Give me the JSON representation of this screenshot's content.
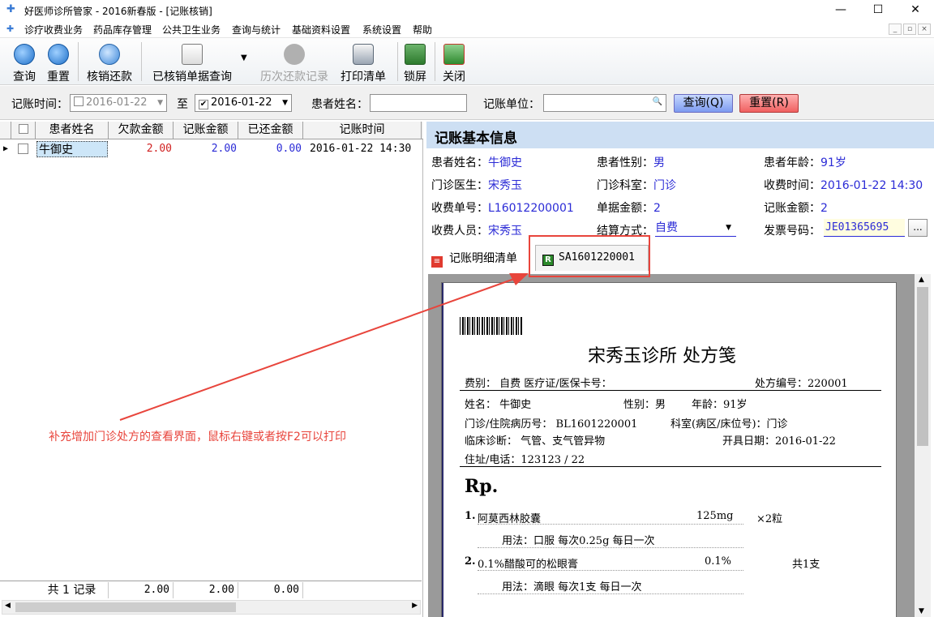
{
  "window": {
    "title": "好医师诊所管家 - 2016新春版 - [记账核销]",
    "minimize": "—",
    "maximize": "☐",
    "close": "✕"
  },
  "menu": [
    "诊疗收费业务",
    "药品库存管理",
    "公共卫生业务",
    "查询与统计",
    "基础资料设置",
    "系统设置",
    "帮助"
  ],
  "toolbar": {
    "query": "查询",
    "reset": "重置",
    "writeoff_repay": "核销还款",
    "writeoff_query": "已核销单据查询",
    "history": "历次还款记录",
    "print": "打印清单",
    "lock": "锁屏",
    "close": "关闭"
  },
  "filter": {
    "time_label": "记账时间：",
    "date_from": "2016-01-22",
    "to_label": "至",
    "date_to": "2016-01-22",
    "patient_label": "患者姓名：",
    "unit_label": "记账单位：",
    "query_btn": "查询(Q)",
    "reset_btn": "重置(R)"
  },
  "grid": {
    "headers": [
      "患者姓名",
      "欠款金额",
      "记账金额",
      "已还金额",
      "记账时间"
    ],
    "rows": [
      {
        "name": "牛御史",
        "owed": "2.00",
        "charged": "2.00",
        "repaid": "0.00",
        "time": "2016-01-22 14:30"
      }
    ],
    "summary": {
      "count_label": "共 1 记录",
      "owed": "2.00",
      "charged": "2.00",
      "repaid": "0.00"
    }
  },
  "info": {
    "title": "记账基本信息",
    "patient_name_label": "患者姓名：",
    "patient_name": "牛御史",
    "gender_label": "患者性别：",
    "gender": "男",
    "age_label": "患者年龄：",
    "age": "91岁",
    "doctor_label": "门诊医生：",
    "doctor": "宋秀玉",
    "dept_label": "门诊科室：",
    "dept": "门诊",
    "charge_time_label": "收费时间：",
    "charge_time": "2016-01-22 14:30",
    "charge_no_label": "收费单号：",
    "charge_no": "L16012200001",
    "bill_amount_label": "单据金额：",
    "bill_amount": "2",
    "charged_amount_label": "记账金额：",
    "charged_amount": "2",
    "cashier_label": "收费人员：",
    "cashier": "宋秀玉",
    "settle_label": "结算方式：",
    "settle": "自费",
    "invoice_label": "发票号码：",
    "invoice": "JE01365695",
    "browse_btn": "..."
  },
  "tabs": {
    "detail": "记账明细清单",
    "rx": "SA1601220001"
  },
  "prescription": {
    "clinic_title": "宋秀玉诊所  处方笺",
    "fee_type": "费别：   自费   医疗证/医保卡号：",
    "rx_no": "处方编号：220001",
    "name_line": "姓名：   牛御史",
    "gender_line": "性别：男",
    "age_line": "年龄：91岁",
    "record_line": "门诊/住院病历号： BL1601220001",
    "dept_line": "科室(病区/床位号)：门诊",
    "diag_line": "临床诊断： 气管、支气管异物",
    "date_line": "开具日期：2016-01-22",
    "addr_line": "住址/电话：123123 / 22",
    "rp": "Rp.",
    "items": [
      {
        "no": "1.",
        "name": "阿莫西林胶囊",
        "spec": "125mg",
        "qty": "×2粒",
        "usage": "用法：口服   每次0.25g   每日一次"
      },
      {
        "no": "2.",
        "name": "0.1%醋酸可的松眼膏",
        "spec": "0.1%",
        "qty": "共1支",
        "usage": "用法：滴眼   每次1支   每日一次"
      }
    ]
  },
  "annotation": "补充增加门诊处方的查看界面，鼠标右键或者按F2可以打印",
  "colors": {
    "accent_red": "#e8453c",
    "value_blue": "#2b2bd6",
    "header_blue": "#cddff3"
  }
}
